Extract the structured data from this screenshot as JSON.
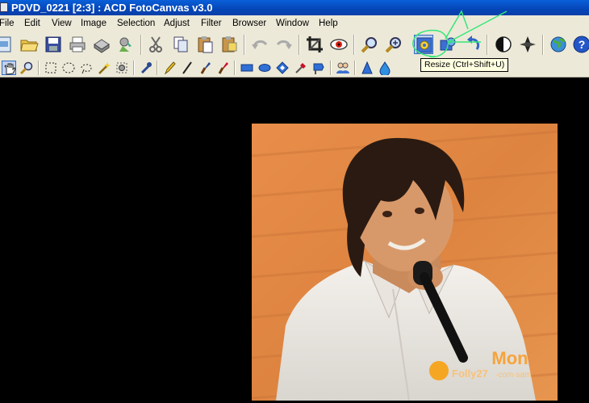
{
  "window": {
    "title": "PDVD_0221 [2:3] : ACD FotoCanvas v3.0"
  },
  "menu": {
    "items": [
      "File",
      "Edit",
      "View",
      "Image",
      "Selection",
      "Adjust",
      "Filter",
      "Browser",
      "Window",
      "Help"
    ]
  },
  "toolbar": {
    "tooltip": "Resize (Ctrl+Shift+U)",
    "icons": [
      "new-icon",
      "open-icon",
      "save-icon",
      "print-icon",
      "scan-icon",
      "acquire-icon",
      "cut-icon",
      "copy-icon",
      "paste-icon",
      "paste-new-icon",
      "undo-icon",
      "redo-icon",
      "crop-icon",
      "red-eye-icon",
      "zoom-out-icon",
      "zoom-in-icon",
      "resize-icon",
      "rotate-icon",
      "flip-icon",
      "contrast-icon",
      "sharpen-icon",
      "web-icon",
      "help-icon"
    ]
  },
  "tools": {
    "icons": [
      "hand-tool-icon",
      "zoom-tool-icon",
      "rect-select-icon",
      "ellipse-select-icon",
      "lasso-icon",
      "magic-wand-icon",
      "clone-icon",
      "eyedropper-icon",
      "pencil-icon",
      "line-icon",
      "brush-icon",
      "airbrush-icon",
      "rectangle-icon",
      "ellipse-icon",
      "polygon-icon",
      "fill-icon",
      "text-icon",
      "people-icon",
      "sharpen-tool-icon",
      "blur-tool-icon"
    ]
  },
  "image": {
    "watermark_line1": "Mon",
    "watermark_line2": "Folly27",
    "watermark_line3": "·com·sam"
  },
  "colors": {
    "titlebar": "#0546b8",
    "chrome": "#ece9d8",
    "annotation": "#35e879",
    "tooltip_bg": "#ffffe1"
  }
}
